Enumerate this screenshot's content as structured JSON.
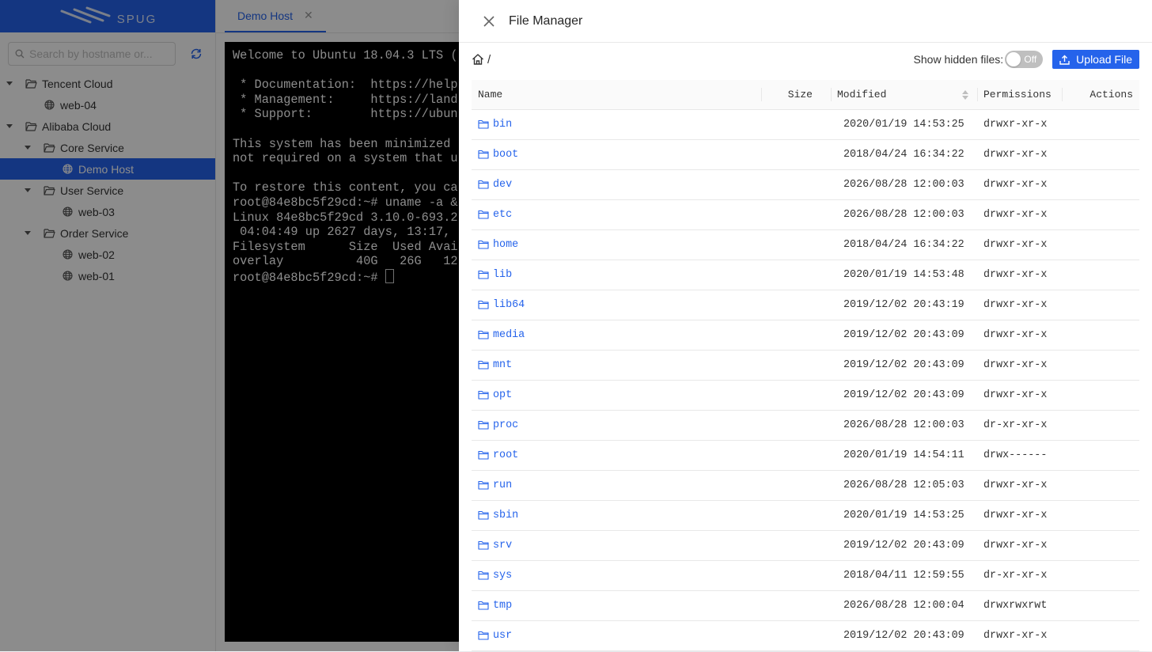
{
  "sidebar": {
    "logo_text": "SPUG",
    "search_placeholder": "Search by hostname or...",
    "tree": [
      {
        "label": "Tencent Cloud",
        "level": 0,
        "type": "group",
        "expanded": true
      },
      {
        "label": "web-04",
        "level": 1,
        "type": "host"
      },
      {
        "label": "Alibaba Cloud",
        "level": 0,
        "type": "group",
        "expanded": true
      },
      {
        "label": "Core Service",
        "level": 1,
        "type": "group",
        "expanded": true
      },
      {
        "label": "Demo Host",
        "level": 2,
        "type": "host",
        "selected": true
      },
      {
        "label": "User Service",
        "level": 1,
        "type": "group",
        "expanded": true
      },
      {
        "label": "web-03",
        "level": 2,
        "type": "host"
      },
      {
        "label": "Order Service",
        "level": 1,
        "type": "group",
        "expanded": true
      },
      {
        "label": "web-02",
        "level": 2,
        "type": "host"
      },
      {
        "label": "web-01",
        "level": 2,
        "type": "host"
      }
    ]
  },
  "tabs": [
    {
      "label": "Demo Host"
    }
  ],
  "terminal": {
    "lines": [
      "Welcome to Ubuntu 18.04.3 LTS (",
      "",
      " * Documentation:  https://help",
      " * Management:     https://land",
      " * Support:        https://ubun",
      "",
      "This system has been minimized ",
      "not required on a system that u",
      "",
      "To restore this content, you ca",
      "root@84e8bc5f29cd:~# uname -a &",
      "Linux 84e8bc5f29cd 3.10.0-693.2",
      " 04:04:49 up 2627 days, 13:17, ",
      "Filesystem      Size  Used Avai",
      "overlay          40G   26G   12",
      "root@84e8bc5f29cd:~# "
    ]
  },
  "drawer": {
    "title": "File Manager",
    "breadcrumb": "/",
    "hidden_files_label": "Show hidden files:",
    "switch_text": "Off",
    "upload_label": "Upload File",
    "columns": {
      "name": "Name",
      "size": "Size",
      "modified": "Modified",
      "permissions": "Permissions",
      "actions": "Actions"
    },
    "files": [
      {
        "name": "bin",
        "modified": "2020/01/19 14:53:25",
        "perm": "drwxr-xr-x"
      },
      {
        "name": "boot",
        "modified": "2018/04/24 16:34:22",
        "perm": "drwxr-xr-x"
      },
      {
        "name": "dev",
        "modified": "2026/08/28 12:00:03",
        "perm": "drwxr-xr-x"
      },
      {
        "name": "etc",
        "modified": "2026/08/28 12:00:03",
        "perm": "drwxr-xr-x"
      },
      {
        "name": "home",
        "modified": "2018/04/24 16:34:22",
        "perm": "drwxr-xr-x"
      },
      {
        "name": "lib",
        "modified": "2020/01/19 14:53:48",
        "perm": "drwxr-xr-x"
      },
      {
        "name": "lib64",
        "modified": "2019/12/02 20:43:19",
        "perm": "drwxr-xr-x"
      },
      {
        "name": "media",
        "modified": "2019/12/02 20:43:09",
        "perm": "drwxr-xr-x"
      },
      {
        "name": "mnt",
        "modified": "2019/12/02 20:43:09",
        "perm": "drwxr-xr-x"
      },
      {
        "name": "opt",
        "modified": "2019/12/02 20:43:09",
        "perm": "drwxr-xr-x"
      },
      {
        "name": "proc",
        "modified": "2026/08/28 12:00:03",
        "perm": "dr-xr-xr-x"
      },
      {
        "name": "root",
        "modified": "2020/01/19 14:54:11",
        "perm": "drwx------"
      },
      {
        "name": "run",
        "modified": "2026/08/28 12:05:03",
        "perm": "drwxr-xr-x"
      },
      {
        "name": "sbin",
        "modified": "2020/01/19 14:53:25",
        "perm": "drwxr-xr-x"
      },
      {
        "name": "srv",
        "modified": "2019/12/02 20:43:09",
        "perm": "drwxr-xr-x"
      },
      {
        "name": "sys",
        "modified": "2018/04/11 12:59:55",
        "perm": "dr-xr-xr-x"
      },
      {
        "name": "tmp",
        "modified": "2026/08/28 12:00:04",
        "perm": "drwxrwxrwt"
      },
      {
        "name": "usr",
        "modified": "2019/12/02 20:43:09",
        "perm": "drwxr-xr-x"
      }
    ]
  },
  "colors": {
    "accent": "#2563eb",
    "mask": "rgba(0,0,0,0.45)"
  },
  "icons": {
    "tree_group": "folder-open-icon",
    "tree_host": "server-icon",
    "row": "folder-icon",
    "home": "home-icon",
    "refresh": "refresh-icon",
    "close": "close-icon",
    "upload": "upload-icon"
  }
}
